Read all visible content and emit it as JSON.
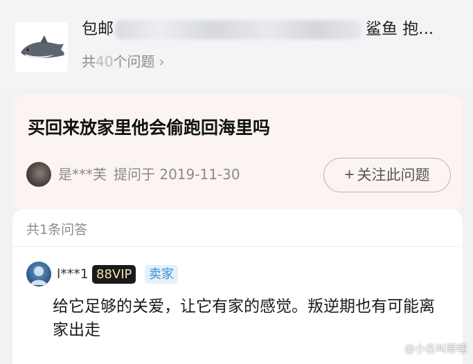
{
  "product": {
    "title_prefix": "包邮",
    "title_suffix": "鲨鱼 抱...",
    "question_count_prefix": "共",
    "question_count_num": "40",
    "question_count_suffix": "个问题",
    "chevron_glyph": "›"
  },
  "question": {
    "text": "买回来放家里他会偷跑回海里吗",
    "asker": "是***芙",
    "asked_at": "提问于 2019-11-30",
    "follow_label": "关注此问题",
    "follow_icon": "plus-icon"
  },
  "answers": {
    "count_label": "共1条问答",
    "items": [
      {
        "user": "l***1",
        "vip_label": "88VIP",
        "role_label": "卖家",
        "text": "给它足够的关爱，让它有家的感觉。叛逆期也有可能离家出走"
      }
    ]
  },
  "watermark": {
    "text": "@小名叫蒂哩",
    "icon": "weibo-icon"
  },
  "colors": {
    "page_bg": "#f2f2f4",
    "question_card_bg": "#fbf4f0",
    "vip_bg": "#1a1a1a",
    "vip_text": "#f1e1b4",
    "seller_bg": "#e4f1fb",
    "seller_text": "#3d8fd1"
  }
}
